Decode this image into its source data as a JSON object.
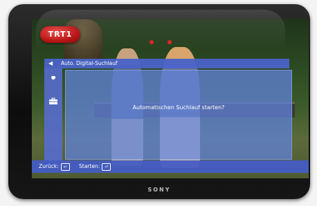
{
  "device": {
    "brand": "SONY"
  },
  "channel": {
    "logo_text": "TRT1"
  },
  "menu": {
    "back_arrow_icon": "left-triangle-icon",
    "title": "Auto. Digital-Suchlauf",
    "side_icons": [
      "wrench-icon",
      "toolbox-icon"
    ]
  },
  "dialog": {
    "message": "Automatischen Suchlauf starten?"
  },
  "footer": {
    "back_label": "Zurück:",
    "start_label": "Starten:",
    "back_key_icon": "back-key-icon",
    "start_key_icon": "enter-key-icon"
  },
  "colors": {
    "menu_blue": "#4a63c8",
    "dialog_blue": "#6082dc",
    "logo_red": "#b70d0d"
  }
}
